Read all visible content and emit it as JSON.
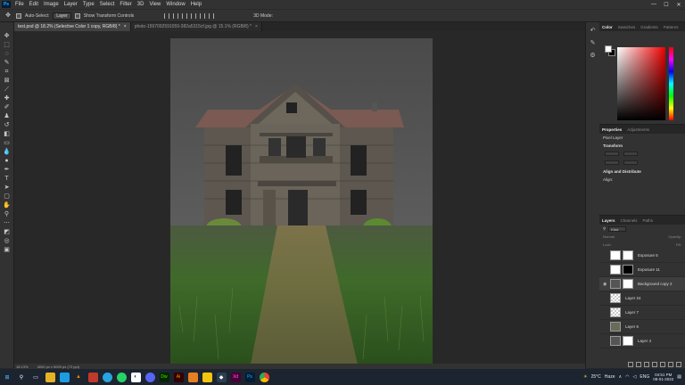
{
  "app": {
    "logo": "Ps"
  },
  "menu": [
    "File",
    "Edit",
    "Image",
    "Layer",
    "Type",
    "Select",
    "Filter",
    "3D",
    "View",
    "Window",
    "Help"
  ],
  "window_controls": {
    "minimize": "—",
    "maximize": "☐",
    "close": "✕"
  },
  "options": {
    "auto_select_label": "Auto-Select:",
    "auto_select_value": "Layer",
    "transform_label": "Show Transform Controls",
    "mode_label": "3D Mode:"
  },
  "tabs": [
    {
      "label": "test.psd @ 18.2% (Selective Color 1 copy, RGB/8) *",
      "close": "×"
    },
    {
      "label": "photo-1597092591059-382a5315cf.jpg @ 15.1% (RGB/8) *",
      "close": "×"
    }
  ],
  "status": {
    "zoom": "18.13%",
    "doc": "4000 px x 5000 px (72 ppi)"
  },
  "panels": {
    "color_tabs": [
      "Color",
      "Swatches",
      "Gradients",
      "Patterns"
    ],
    "properties_tabs": [
      "Properties",
      "Adjustments"
    ],
    "pixel_layer": "Pixel Layer",
    "transform": "Transform",
    "align": "Align and Distribute",
    "align_sub": "Align:",
    "layers_tabs": [
      "Layers",
      "Channels",
      "Paths"
    ],
    "kind": "Kind",
    "blend": "Normal",
    "opacity": "Opacity:",
    "lock": "Lock:",
    "fill": "Fill:"
  },
  "layers": [
    {
      "name": "Exposure 5",
      "thumb": "white",
      "mask": "white"
    },
    {
      "name": "Exposure 11",
      "thumb": "white",
      "mask": "black"
    },
    {
      "name": "Background copy 2",
      "thumb": "house",
      "mask": "white"
    },
    {
      "name": "Layer 24",
      "thumb": "check",
      "mask": ""
    },
    {
      "name": "Layer 7",
      "thumb": "check",
      "mask": ""
    },
    {
      "name": "Layer 6",
      "thumb": "grass",
      "mask": ""
    },
    {
      "name": "Layer 4",
      "thumb": "house",
      "mask": "white"
    }
  ],
  "taskbar": {
    "weather_temp": "25°C",
    "weather_desc": "Haze",
    "lang": "ENG",
    "time": "04:51 PM",
    "date": "08-01-2022"
  },
  "colors": {
    "accent": "#31a8ff",
    "panel": "#323232",
    "taskbar": "#1c2430"
  }
}
